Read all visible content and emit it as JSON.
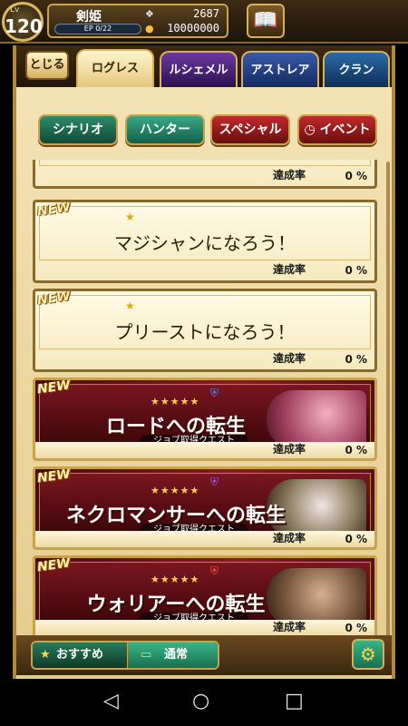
{
  "player": {
    "level_label": "Lv",
    "level": "120",
    "name": "剣姫",
    "ep_text": "EP 0/22",
    "ep_fraction": 0.0,
    "gems": "2687",
    "coins": "10000000"
  },
  "header": {
    "close_label": "とじる"
  },
  "tabs": [
    {
      "label": "ログレス",
      "active": true
    },
    {
      "label": "ルシェメル",
      "active": false
    },
    {
      "label": "アストレア",
      "active": false
    },
    {
      "label": "クラン",
      "active": false
    }
  ],
  "filters": [
    {
      "label": "シナリオ"
    },
    {
      "label": "ハンター"
    },
    {
      "label": "スペシャル"
    },
    {
      "label": "イベント"
    }
  ],
  "quests": {
    "rate_label": "達成率",
    "new_badge": "NEW",
    "items": [
      {
        "title": "",
        "rate": "0 %"
      },
      {
        "title": "マジシャンになろう！",
        "rate": "0 %"
      },
      {
        "title": "プリーストになろう！",
        "rate": "0 %"
      },
      {
        "title": "ロードへの転生",
        "subtitle": "ジョブ取得クエスト",
        "stars": "★★★★★",
        "rate": "0 %"
      },
      {
        "title": "ネクロマンサーへの転生",
        "subtitle": "ジョブ取得クエスト",
        "stars": "★★★★★",
        "rate": "0 %"
      },
      {
        "title": "ウォリアーへの転生",
        "subtitle": "ジョブ取得クエスト",
        "stars": "★★★★★",
        "rate": "0 %"
      }
    ]
  },
  "bottom": {
    "recommended_label": "おすすめ",
    "normal_label": "通常"
  },
  "colors": {
    "accent_gold": "#c9a24b",
    "job_red": "#8a1a22",
    "green": "#177050"
  }
}
